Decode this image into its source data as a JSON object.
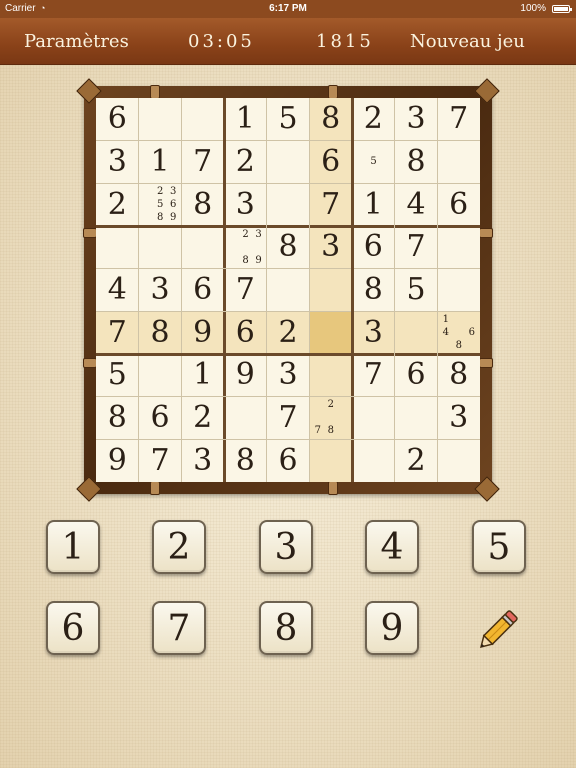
{
  "status_bar": {
    "carrier": "Carrier",
    "time": "6:17 PM",
    "battery": "100%",
    "battery_level": 1.0
  },
  "nav": {
    "settings": "Paramètres",
    "timer": "03:05",
    "score": "1815",
    "new_game": "Nouveau jeu"
  },
  "board": {
    "grid": [
      [
        6,
        0,
        0,
        1,
        5,
        8,
        2,
        3,
        7
      ],
      [
        3,
        1,
        7,
        2,
        0,
        6,
        0,
        8,
        0
      ],
      [
        2,
        0,
        8,
        3,
        0,
        7,
        1,
        4,
        6
      ],
      [
        0,
        0,
        0,
        0,
        8,
        3,
        6,
        7,
        0
      ],
      [
        4,
        3,
        6,
        7,
        0,
        0,
        8,
        5,
        0
      ],
      [
        7,
        8,
        9,
        6,
        2,
        0,
        3,
        0,
        0
      ],
      [
        5,
        0,
        1,
        9,
        3,
        0,
        7,
        6,
        8
      ],
      [
        8,
        6,
        2,
        0,
        7,
        0,
        0,
        0,
        3
      ],
      [
        9,
        7,
        3,
        8,
        6,
        0,
        0,
        2,
        0
      ]
    ],
    "notes": [
      {
        "row": 1,
        "col": 6,
        "digits": [
          5
        ]
      },
      {
        "row": 2,
        "col": 1,
        "digits": [
          2,
          3,
          5,
          6,
          8,
          9
        ]
      },
      {
        "row": 3,
        "col": 3,
        "digits": [
          2,
          3,
          8,
          9
        ]
      },
      {
        "row": 5,
        "col": 8,
        "digits": [
          1,
          4,
          6,
          8
        ]
      },
      {
        "row": 7,
        "col": 5,
        "digits": [
          2,
          7,
          8
        ]
      }
    ],
    "selected": {
      "row": 5,
      "col": 5
    },
    "colors": {
      "highlight": "#f4e4bd",
      "selected": "#e7c77d",
      "cell_bg": "#fbf6e6"
    }
  },
  "keypad": {
    "digits": [
      "1",
      "2",
      "3",
      "4",
      "5",
      "6",
      "7",
      "8",
      "9"
    ],
    "pencil_icon": "pencil-icon"
  },
  "colors": {
    "nav_bg": "#8a4219",
    "frame": "#5a3415"
  }
}
